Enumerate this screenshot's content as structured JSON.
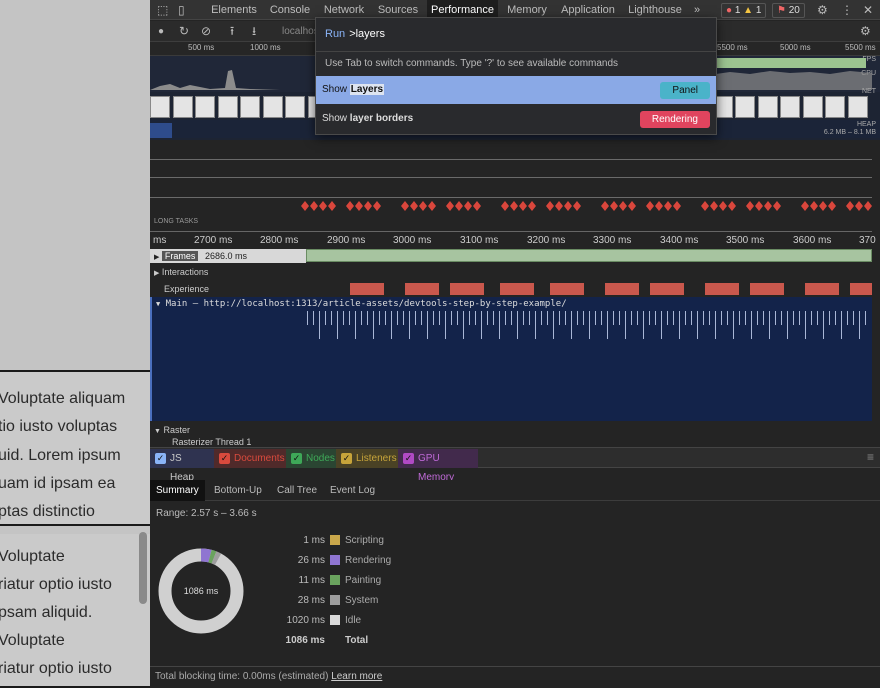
{
  "page": {
    "block1_lines": [
      "Voluptate aliquam",
      "tio iusto voluptas",
      "uid. Lorem ipsum",
      "uam id ipsam ea",
      "ptas distinctio"
    ],
    "block2_lines": [
      "Voluptate",
      "riatur optio iusto",
      "psam aliquid.",
      "Voluptate",
      "riatur optio iusto"
    ]
  },
  "devtools": {
    "tabs": [
      "Elements",
      "Console",
      "Network",
      "Sources",
      "Performance",
      "Memory",
      "Application",
      "Lighthouse"
    ],
    "active_tab": "Performance",
    "more_tabs": "»",
    "badges": {
      "errors": "1",
      "warnings": "1",
      "issues": "20"
    },
    "url_partial": "localhos",
    "ruler_ticks": [
      "500 ms",
      "1000 ms",
      "5500 ms",
      "5000 ms",
      "5500 ms"
    ],
    "overview_labels": {
      "fps": "FPS",
      "cpu": "CPU",
      "net": "NET",
      "heap": "HEAP",
      "heap_range": "6.2 MB – 8.1 MB"
    },
    "long_tasks_label": "LONG TASKS",
    "time_axis": [
      "ms",
      "2700 ms",
      "2800 ms",
      "2900 ms",
      "3000 ms",
      "3100 ms",
      "3200 ms",
      "3300 ms",
      "3400 ms",
      "3500 ms",
      "3600 ms",
      "370"
    ],
    "frames": {
      "label": "Frames",
      "value": "2686.0 ms"
    },
    "interactions_label": "Interactions",
    "experience_label": "Experience",
    "main_title": "Main — http://localhost:1313/article-assets/devtools-step-by-step-example/",
    "raster_label": "Raster",
    "raster_thread": "Rasterizer Thread 1",
    "memory_checkboxes": [
      {
        "label": "JS Heap",
        "color": "#8ab4f8",
        "bg": "#2f3350"
      },
      {
        "label": "Documents",
        "color": "#d94a3d",
        "bg": "#502a2a"
      },
      {
        "label": "Nodes",
        "color": "#3ea858",
        "bg": "#2a4532"
      },
      {
        "label": "Listeners",
        "color": "#c7a43a",
        "bg": "#4a4225"
      },
      {
        "label": "GPU Memory",
        "color": "#b04ac4",
        "bg": "#422a4c"
      }
    ],
    "bottom_tabs": [
      "Summary",
      "Bottom-Up",
      "Call Tree",
      "Event Log"
    ],
    "active_bottom_tab": "Summary",
    "range": "Range: 2.57 s – 3.66 s",
    "donut_total": "1086 ms",
    "summary": [
      {
        "ms": "1 ms",
        "name": "Scripting",
        "color": "#c9a74b"
      },
      {
        "ms": "26 ms",
        "name": "Rendering",
        "color": "#8f75d1"
      },
      {
        "ms": "11 ms",
        "name": "Painting",
        "color": "#6aa35e"
      },
      {
        "ms": "28 ms",
        "name": "System",
        "color": "#9e9e9e"
      },
      {
        "ms": "1020 ms",
        "name": "Idle",
        "color": "#d9d9d9"
      }
    ],
    "summary_total": {
      "ms": "1086 ms",
      "name": "Total"
    },
    "footer_text": "Total blocking time: 0.00ms (estimated)",
    "footer_link": "Learn more"
  },
  "command_menu": {
    "run_label": "Run",
    "query": ">layers",
    "hint": "Use Tab to switch commands. Type '?' to see available commands",
    "items": [
      {
        "prefix": "Show ",
        "match": "Layers",
        "suffix": "",
        "pill": "Panel",
        "pill_color": "#4ab3c9"
      },
      {
        "prefix": "Show ",
        "match": "layer",
        "suffix": " borders",
        "pill": "Rendering",
        "pill_color": "#e0445e"
      }
    ]
  }
}
